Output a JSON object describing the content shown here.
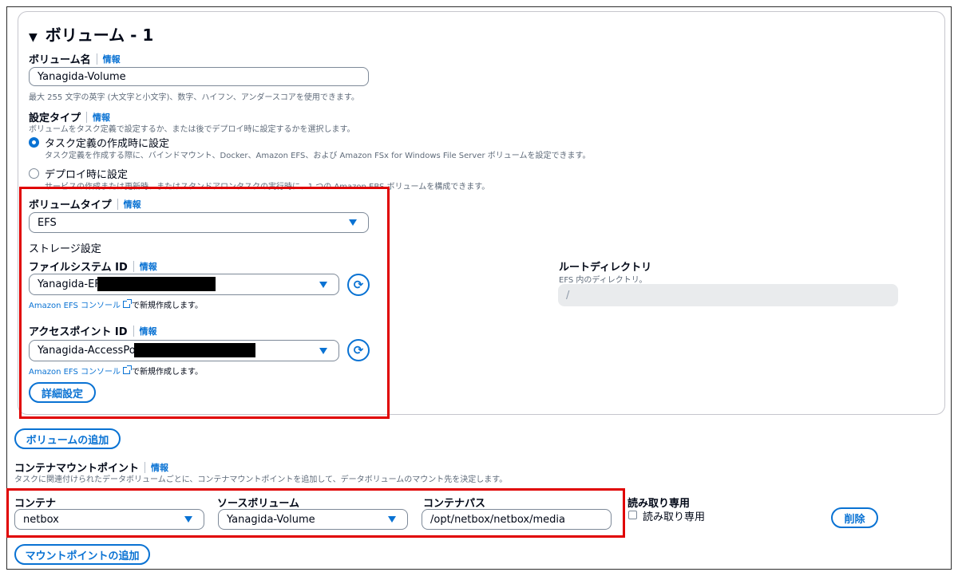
{
  "volume": {
    "title": "ボリューム - 1",
    "name_label": "ボリューム名",
    "info": "情報",
    "name_value": "Yanagida-Volume",
    "name_hint": "最大 255 文字の英字 (大文字と小文字)、数字、ハイフン、アンダースコアを使用できます。",
    "config_type_label": "設定タイプ",
    "config_type_desc": "ボリュームをタスク定義で設定するか、または後でデプロイ時に設定するかを選択します。",
    "option1_label": "タスク定義の作成時に設定",
    "option1_desc": "タスク定義を作成する際に、バインドマウント、Docker、Amazon EFS、および Amazon FSx for Windows File Server ボリュームを設定できます。",
    "option2_label": "デプロイ時に設定",
    "option2_desc": "サービスの作成または更新時、またはスタンドアロンタスクの実行時に、1 つの Amazon EBS ボリュームを構成できます。",
    "volume_type_label": "ボリュームタイプ",
    "volume_type_value": "EFS",
    "storage_settings": "ストレージ設定",
    "fs_id_label": "ファイルシステム ID",
    "fs_id_value": "Yanagida-EFS",
    "efs_console_link": "Amazon EFS コンソール",
    "new_create_text": "で新規作成します。",
    "ap_id_label": "アクセスポイント ID",
    "ap_id_value": "Yanagida-AccessPoint",
    "advanced_button": "詳細設定",
    "root_dir_label": "ルートディレクトリ",
    "root_dir_desc": "EFS 内のディレクトリ。",
    "root_dir_value": "/"
  },
  "add_volume_button": "ボリュームの追加",
  "mount": {
    "label": "コンテナマウントポイント",
    "info": "情報",
    "desc": "タスクに関連付けられたデータボリュームごとに、コンテナマウントポイントを追加して、データボリュームのマウント先を決定します。",
    "col_container": "コンテナ",
    "col_source": "ソースボリューム",
    "col_path": "コンテナパス",
    "col_readonly": "読み取り専用",
    "container_value": "netbox",
    "source_value": "Yanagida-Volume",
    "path_value": "/opt/netbox/netbox/media",
    "readonly_checkbox_label": "読み取り専用",
    "delete_button": "削除",
    "add_mount_button": "マウントポイントの追加"
  },
  "colors": {
    "accent": "#0972d3",
    "highlight": "#e00000"
  },
  "icons": {
    "refresh": "refresh-icon",
    "external": "external-link-icon",
    "caret": "caret-down-icon"
  }
}
